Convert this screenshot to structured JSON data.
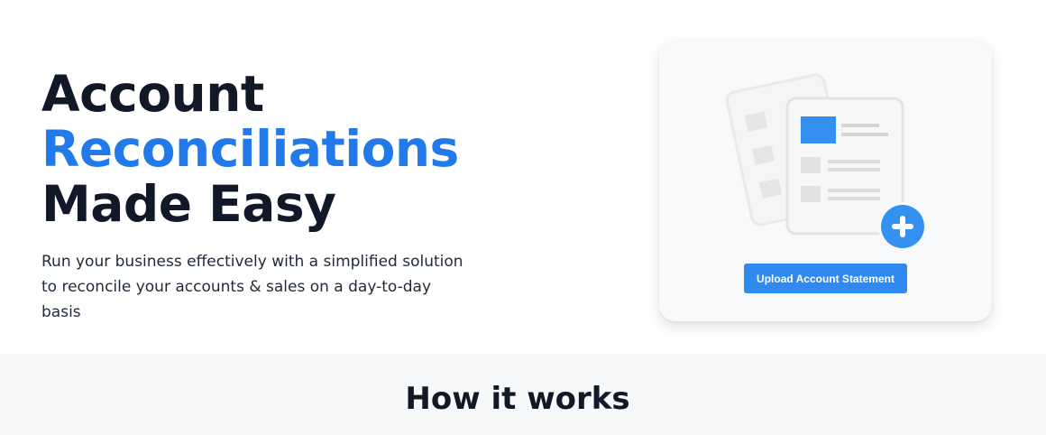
{
  "hero": {
    "headline_line1": "Account",
    "headline_line2": "Reconciliations",
    "headline_line3": "Made Easy",
    "subtitle": "Run your business effectively with a simplified solution to reconcile your accounts & sales on a day-to-day basis"
  },
  "upload_card": {
    "illustration_icon": "documents-add-icon",
    "button_label": "Upload Account Statement"
  },
  "how_it_works": {
    "title": "How it works"
  },
  "colors": {
    "accent": "#2179ea",
    "button": "#2f89f0",
    "heading": "#111827",
    "card_background": "#f8f9fa",
    "section_background": "#f7f8f9"
  }
}
